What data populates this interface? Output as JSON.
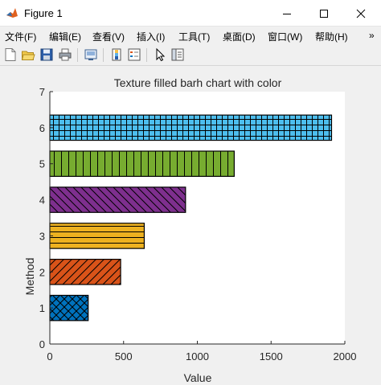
{
  "window": {
    "title": "Figure 1"
  },
  "menu": {
    "items": [
      "文件(F)",
      "编辑(E)",
      "查看(V)",
      "插入(I)",
      "工具(T)",
      "桌面(D)",
      "窗口(W)",
      "帮助(H)"
    ],
    "overflow": "»"
  },
  "toolbar": {
    "buttons": [
      "new-figure-icon",
      "open-file-icon",
      "save-icon",
      "print-icon",
      "link-plot-icon",
      "colorbar-icon",
      "legend-icon",
      "pointer-icon",
      "property-editor-icon"
    ]
  },
  "colors": {
    "background": "#f0f0f0",
    "axes_bg": "#ffffff",
    "hatch": "#000000"
  },
  "chart_data": {
    "type": "bar",
    "orientation": "horizontal",
    "title": "Texture filled barh chart with color",
    "xlabel": "Value",
    "ylabel": "Method",
    "categories": [
      1,
      2,
      3,
      4,
      5,
      6
    ],
    "values": [
      260,
      480,
      640,
      920,
      1250,
      1910
    ],
    "bar_colors": [
      "#0072bd",
      "#d95319",
      "#edb120",
      "#7e2f8e",
      "#77ac30",
      "#4dbeee"
    ],
    "hatches": [
      "crosshatch",
      "diagonal",
      "horizontal",
      "backdiagonal",
      "vertical",
      "grid"
    ],
    "xlim": [
      0,
      2000
    ],
    "ylim": [
      0,
      7
    ],
    "xticks": [
      0,
      500,
      1000,
      1500,
      2000
    ],
    "yticks": [
      0,
      1,
      2,
      3,
      4,
      5,
      6,
      7
    ],
    "grid": false
  }
}
